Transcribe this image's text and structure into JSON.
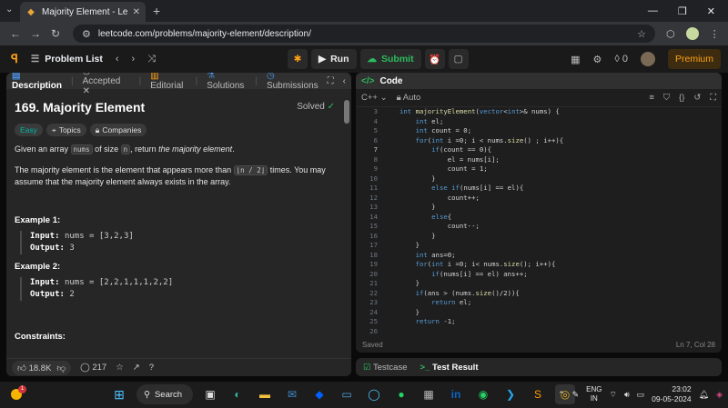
{
  "browser": {
    "tab_title": "Majority Element - LeetCode",
    "url": "leetcode.com/problems/majority-element/description/"
  },
  "lc_top": {
    "problem_list": "Problem List",
    "run": "Run",
    "submit": "Submit",
    "fire_count": "0",
    "premium": "Premium"
  },
  "left": {
    "tabs": [
      "Description",
      "Accepted",
      "Editorial",
      "Solutions",
      "Submissions"
    ],
    "title": "169. Majority Element",
    "solved": "Solved",
    "tags": [
      "Easy",
      "Topics",
      "Companies"
    ],
    "desc_p1_a": "Given an array ",
    "desc_p1_code1": "nums",
    "desc_p1_b": " of size ",
    "desc_p1_code2": "n",
    "desc_p1_c": ", return ",
    "desc_p1_em": "the majority element",
    "desc_p1_d": ".",
    "desc_p2_a": "The majority element is the element that appears more than ",
    "desc_p2_code": "⌊n / 2⌋",
    "desc_p2_b": " times. You may assume that the majority element always exists in the array.",
    "ex1_title": "Example 1:",
    "ex1_input_label": "Input:",
    "ex1_input": "nums = [3,2,3]",
    "ex1_output_label": "Output:",
    "ex1_output": "3",
    "ex2_title": "Example 2:",
    "ex2_input_label": "Input:",
    "ex2_input": "nums = [2,2,1,1,1,2,2]",
    "ex2_output_label": "Output:",
    "ex2_output": "2",
    "constraints": "Constraints:",
    "likes": "18.8K",
    "comments": "217"
  },
  "right": {
    "header": "Code",
    "language": "C++",
    "mode": "Auto",
    "status_left": "Saved",
    "status_right": "Ln 7, Col 28",
    "code_lines": [
      {
        "n": "3",
        "t": "int majorityElement(vector<int>& nums) {"
      },
      {
        "n": "4",
        "t": "    int el;"
      },
      {
        "n": "5",
        "t": "    int count = 0;"
      },
      {
        "n": "6",
        "t": "    for(int i =0; i < nums.size() ; i++){"
      },
      {
        "n": "7",
        "t": "        if(count == 0){"
      },
      {
        "n": "8",
        "t": "            el = nums[i];"
      },
      {
        "n": "9",
        "t": "            count = 1;"
      },
      {
        "n": "10",
        "t": "        }"
      },
      {
        "n": "11",
        "t": "        else if(nums[i] == el){"
      },
      {
        "n": "12",
        "t": "            count++;"
      },
      {
        "n": "13",
        "t": "        }"
      },
      {
        "n": "14",
        "t": "        else{"
      },
      {
        "n": "15",
        "t": "            count--;"
      },
      {
        "n": "16",
        "t": "        }"
      },
      {
        "n": "17",
        "t": "    }"
      },
      {
        "n": "18",
        "t": "    int ans=0;"
      },
      {
        "n": "19",
        "t": "    for(int i =0; i< nums.size(); i++){"
      },
      {
        "n": "20",
        "t": "        if(nums[i] == el) ans++;"
      },
      {
        "n": "21",
        "t": "    }"
      },
      {
        "n": "22",
        "t": "    if(ans > (nums.size()/2)){"
      },
      {
        "n": "23",
        "t": "        return el;"
      },
      {
        "n": "24",
        "t": "    }"
      },
      {
        "n": "25",
        "t": "    return -1;"
      },
      {
        "n": "26",
        "t": ""
      }
    ]
  },
  "testbar": {
    "testcase": "Testcase",
    "result": "Test Result"
  },
  "taskbar": {
    "search": "Search",
    "weather_badge": "1",
    "lang_top": "ENG",
    "lang_bottom": "IN",
    "time": "23:02",
    "date": "09-05-2024"
  }
}
